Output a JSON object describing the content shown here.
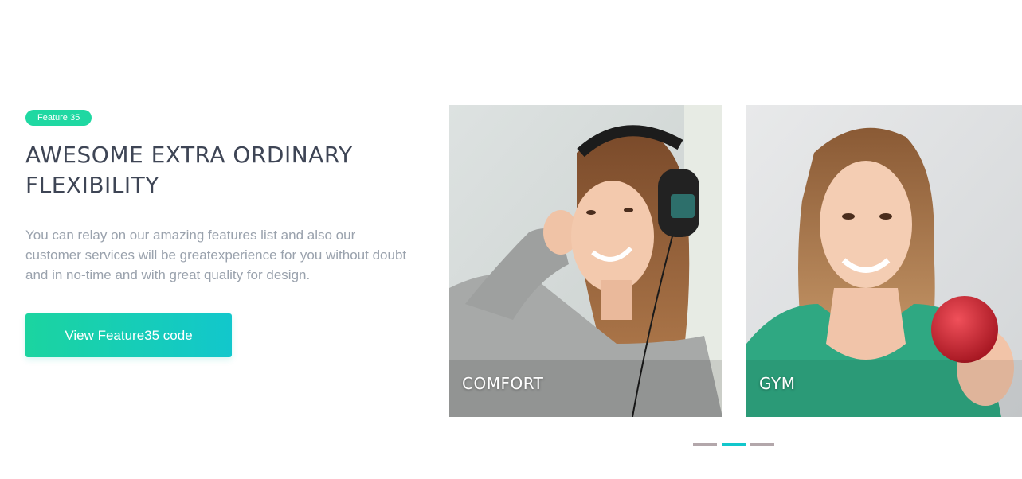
{
  "feature": {
    "badge": "Feature 35",
    "title": "AWESOME EXTRA ORDINARY FLEXIBILITY",
    "description": "You can relay on our amazing features list and also our customer services will be greatexperience for you without doubt and in no-time and with great quality for design.",
    "cta_label": "View Feature35 code"
  },
  "carousel": {
    "cards": [
      {
        "label": "COMFORT",
        "image": "woman-with-headphones"
      },
      {
        "label": "GYM",
        "image": "woman-holding-apple"
      }
    ],
    "pagination": {
      "count": 3,
      "active_index": 1
    }
  },
  "colors": {
    "accent": "#1fd8a2",
    "accent_end": "#12c7cc",
    "heading": "#3e4555",
    "body_text": "#9aa2ad",
    "dot_inactive": "#b3a7ab"
  }
}
